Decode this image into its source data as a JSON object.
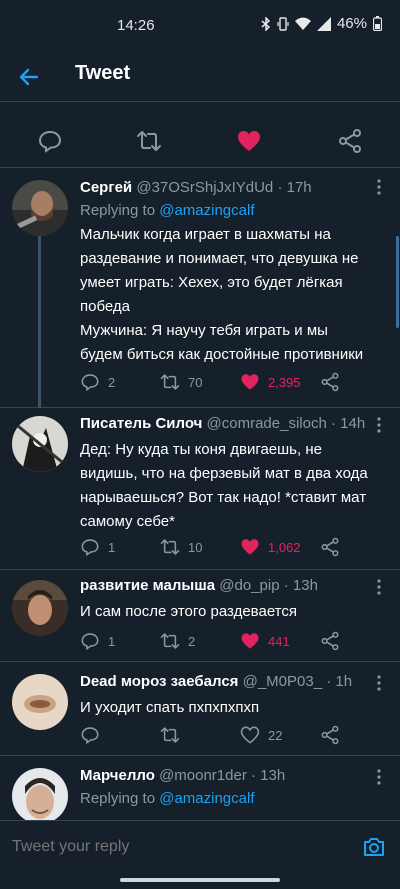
{
  "status_bar": {
    "time": "14:26",
    "battery": "46%"
  },
  "header": {
    "title": "Tweet"
  },
  "colors": {
    "background": "#15202b",
    "accent": "#1da1f2",
    "like": "#e0245e",
    "secondary_text": "#8899a6",
    "divider": "#38444d"
  },
  "action_bar": {
    "icons": [
      "reply-icon",
      "retweet-icon",
      "like-icon-filled",
      "share-icon"
    ]
  },
  "replies": [
    {
      "name": "Сергей",
      "handle": "@37OSrShjJxIYdUd",
      "time": "· 17h",
      "replying_prefix": "Replying to ",
      "replying_to": "@amazingcalf",
      "text": [
        "Мальчик когда играет в шахматы на раздевание и понимает, что девушка не умеет играть: Хехех, это будет лёгкая победа",
        "Мужчина: Я научу тебя играть и мы будем биться как достойные противники"
      ],
      "stats": {
        "replies": "2",
        "retweets": "70",
        "likes": "2,395",
        "liked": true
      }
    },
    {
      "name": "Писатель Силоч",
      "handle": "@comrade_siloch",
      "time": "· 14h",
      "text": [
        "Дед: Ну куда ты коня двигаешь, не видишь, что на ферзевый мат в два хода нарываешься? Вот так надо! *ставит мат самому себе*"
      ],
      "stats": {
        "replies": "1",
        "retweets": "10",
        "likes": "1,062",
        "liked": true
      }
    },
    {
      "name": "развитие малыша",
      "handle": "@do_pip",
      "time": "· 13h",
      "text": [
        "И сам после этого раздевается"
      ],
      "stats": {
        "replies": "1",
        "retweets": "2",
        "likes": "441",
        "liked": true
      }
    },
    {
      "name": "Dead мороз заебался",
      "handle": "@_M0P03_",
      "time": "· 1h",
      "text": [
        "И уходит спать пхпхпхпхп"
      ],
      "stats": {
        "replies": "",
        "retweets": "",
        "likes": "22",
        "liked": false
      }
    },
    {
      "name": "Марчелло",
      "handle": "@moonr1der",
      "time": "· 13h",
      "replying_prefix": "Replying to ",
      "replying_to": "@amazingcalf"
    }
  ],
  "reply_box": {
    "placeholder": "Tweet your reply"
  }
}
